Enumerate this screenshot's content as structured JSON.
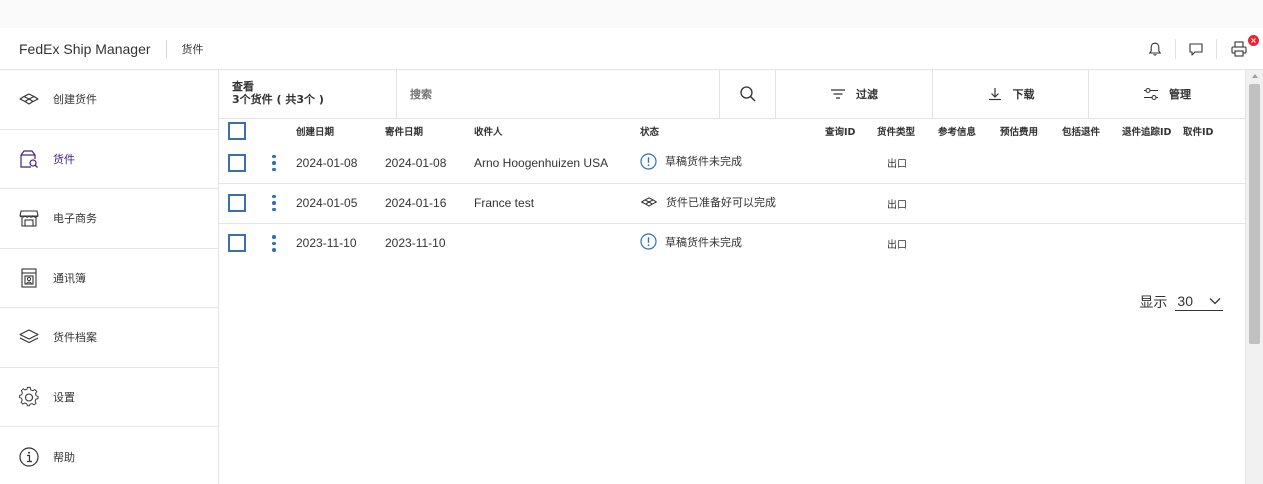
{
  "header": {
    "brand": "FedEx Ship Manager",
    "breadcrumb": "货件",
    "badge_count": "×"
  },
  "sidebar": {
    "items": [
      {
        "label": "创建货件",
        "icon": "create-shipment-icon"
      },
      {
        "label": "货件",
        "icon": "shipments-icon"
      },
      {
        "label": "电子商务",
        "icon": "ecommerce-store-icon"
      },
      {
        "label": "通讯簿",
        "icon": "address-book-icon"
      },
      {
        "label": "货件档案",
        "icon": "shipment-profiles-icon"
      },
      {
        "label": "设置",
        "icon": "settings-gear-icon"
      },
      {
        "label": "帮助",
        "icon": "help-info-icon"
      }
    ]
  },
  "toolbar": {
    "view_title": "查看",
    "view_count": "3个货件 ( 共3个 )",
    "search_placeholder": "搜索",
    "filter_label": "过滤",
    "download_label": "下载",
    "manage_label": "管理"
  },
  "table": {
    "columns": [
      "创建日期",
      "寄件日期",
      "收件人",
      "状态",
      "查询ID",
      "货件类型",
      "参考信息",
      "预估费用",
      "包括退件",
      "退件追踪ID",
      "取件ID"
    ],
    "rows": [
      {
        "created": "2024-01-08",
        "ship_date": "2024-01-08",
        "recipient": "Arno Hoogenhuizen USA",
        "status": "草稿货件未完成",
        "status_icon": "alert-circle-icon",
        "type": "出口"
      },
      {
        "created": "2024-01-05",
        "ship_date": "2024-01-16",
        "recipient": "France test",
        "status": "货件已准备好可以完成",
        "status_icon": "ready-box-icon",
        "type": "出口"
      },
      {
        "created": "2023-11-10",
        "ship_date": "2023-11-10",
        "recipient": "",
        "status": "草稿货件未完成",
        "status_icon": "alert-circle-icon",
        "type": "出口"
      }
    ]
  },
  "pager": {
    "label": "显示",
    "value": "30"
  },
  "colors": {
    "accent_blue": "#2f6fb6",
    "active_purple": "#3f2182",
    "badge_red": "#e32636"
  }
}
